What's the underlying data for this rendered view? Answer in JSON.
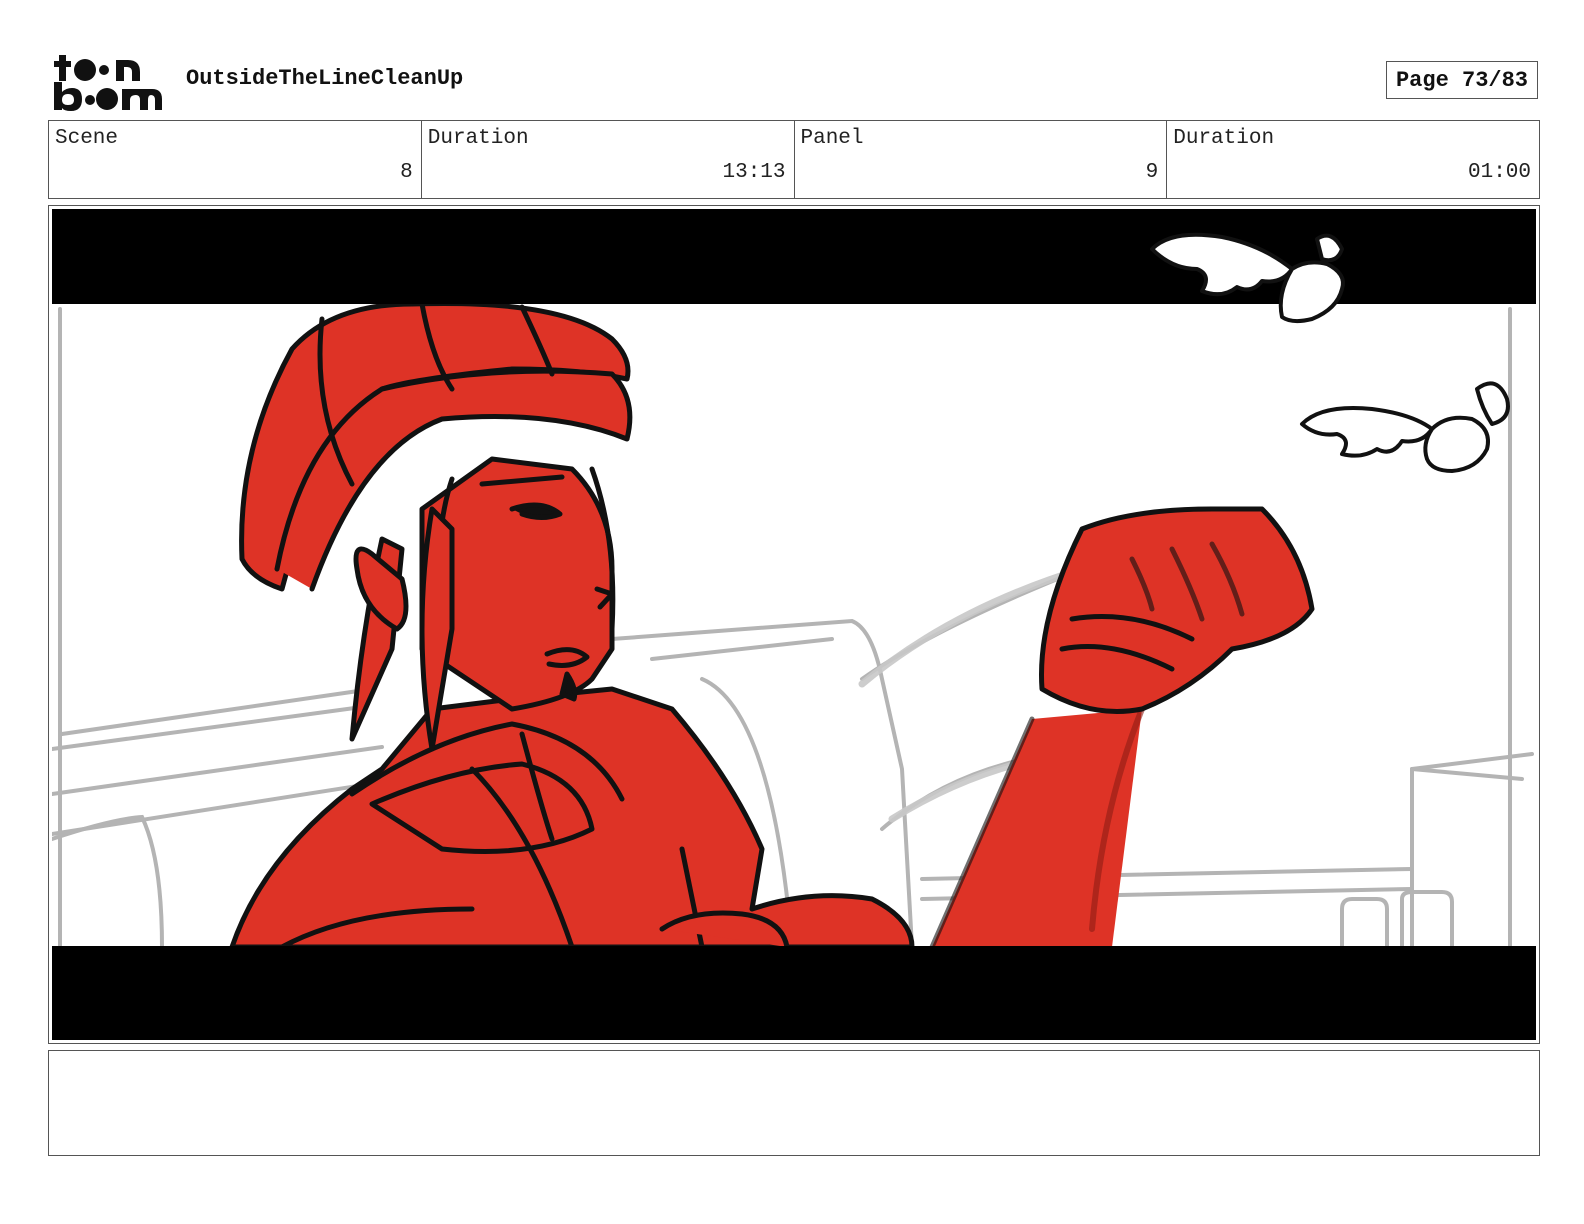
{
  "header": {
    "logo_alt": "toon boom",
    "project_title": "OutsideTheLineCleanUp",
    "page_indicator": "Page 73/83"
  },
  "info": {
    "scene_label": "Scene",
    "scene_value": "8",
    "scene_duration_label": "Duration",
    "scene_duration_value": "13:13",
    "panel_label": "Panel",
    "panel_value": "9",
    "panel_duration_label": "Duration",
    "panel_duration_value": "01:00"
  },
  "colors": {
    "character_red": "#de3326",
    "letterbox": "#000000",
    "sketch_gray": "#b4b4b4"
  },
  "caption": {
    "text": ""
  }
}
